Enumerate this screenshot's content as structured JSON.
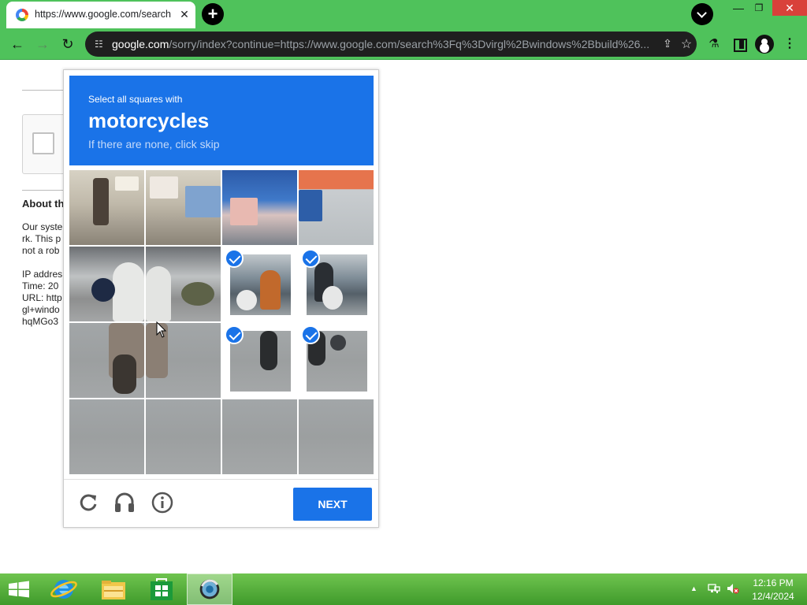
{
  "browser": {
    "tab_title": "https://www.google.com/search",
    "tab_close": "✕",
    "new_tab": "+",
    "url_domain": "google.com",
    "url_path": "/sorry/index?continue=https://www.google.com/search%3Fq%3Dvirgl%2Bwindows%2Bbuild%26...",
    "window_controls": {
      "minimize": "—",
      "restore": "❐",
      "close": "✕"
    }
  },
  "page": {
    "about_heading": "About th",
    "lines": [
      "Our syste",
      "rk. This p",
      "not a rob",
      "",
      "IP addres",
      "Time: 20",
      "URL: http",
      "gl+windo",
      "hqMGo3"
    ]
  },
  "challenge": {
    "instruction": "Select all squares with",
    "target": "motorcycles",
    "hint": "If there are none, click skip",
    "next_label": "NEXT",
    "selected_tiles": [
      6,
      7,
      10,
      11
    ]
  },
  "taskbar": {
    "time": "12:16 PM",
    "date": "12/4/2024"
  },
  "colors": {
    "accent": "#1a73e8",
    "chrome_frame": "#4fc25b",
    "taskbar": "#3f9a2b"
  }
}
